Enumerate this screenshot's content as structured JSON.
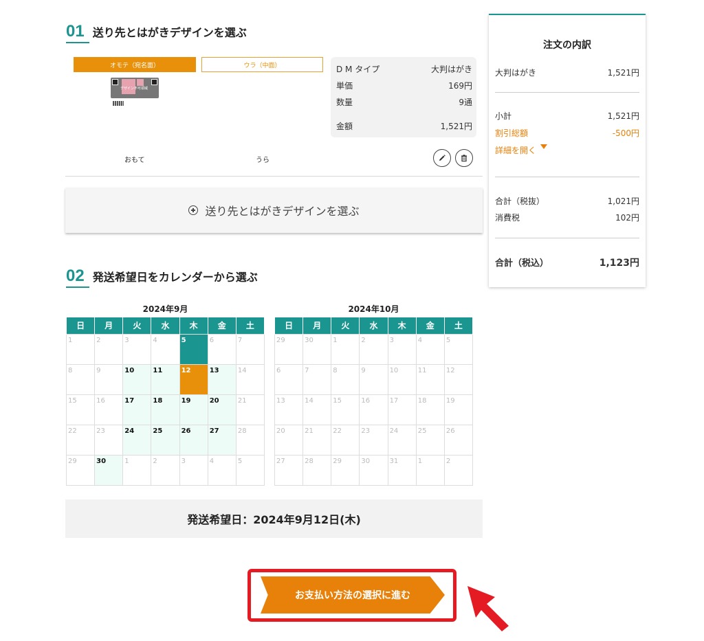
{
  "step1": {
    "num": "01",
    "title": "送り先とはがきデザインを選ぶ"
  },
  "tabs": {
    "front": "オモテ（宛名面）",
    "back": "ウラ（中面）"
  },
  "thumb_text": "デザイン不可領域",
  "summary": {
    "rows": [
      {
        "label": "D M タイプ",
        "value": "大判はがき"
      },
      {
        "label": "単価",
        "value": "169円"
      },
      {
        "label": "数量",
        "value": "9通"
      },
      {
        "label": "金額",
        "value": "1,521円"
      }
    ]
  },
  "face": {
    "front": "おもて",
    "back": "うら"
  },
  "icons": {
    "edit": "pencil-icon",
    "delete": "trash-icon",
    "add": "plus-circle-icon",
    "pointer": "arrow-cursor-icon"
  },
  "add_button": "送り先とはがきデザインを選ぶ",
  "step2": {
    "num": "02",
    "title": "発送希望日をカレンダーから選ぶ"
  },
  "weekdays": [
    "日",
    "月",
    "火",
    "水",
    "木",
    "金",
    "土"
  ],
  "calendars": [
    {
      "title": "2024年9月",
      "weeks": [
        [
          [
            "1",
            "off"
          ],
          [
            "2",
            "off"
          ],
          [
            "3",
            "off"
          ],
          [
            "4",
            "off"
          ],
          [
            "5",
            "today"
          ],
          [
            "6",
            "off"
          ],
          [
            "7",
            "off"
          ]
        ],
        [
          [
            "8",
            "off"
          ],
          [
            "9",
            "off"
          ],
          [
            "10",
            "av"
          ],
          [
            "11",
            "av"
          ],
          [
            "12",
            "sel"
          ],
          [
            "13",
            "av"
          ],
          [
            "14",
            "off"
          ]
        ],
        [
          [
            "15",
            "off"
          ],
          [
            "16",
            "off"
          ],
          [
            "17",
            "av"
          ],
          [
            "18",
            "av"
          ],
          [
            "19",
            "av"
          ],
          [
            "20",
            "av"
          ],
          [
            "21",
            "off"
          ]
        ],
        [
          [
            "22",
            "off"
          ],
          [
            "23",
            "off"
          ],
          [
            "24",
            "av"
          ],
          [
            "25",
            "av"
          ],
          [
            "26",
            "av"
          ],
          [
            "27",
            "av"
          ],
          [
            "28",
            "off"
          ]
        ],
        [
          [
            "29",
            "off"
          ],
          [
            "30",
            "av"
          ],
          [
            "1",
            "off"
          ],
          [
            "2",
            "off"
          ],
          [
            "3",
            "off"
          ],
          [
            "4",
            "off"
          ],
          [
            "5",
            "off"
          ]
        ]
      ]
    },
    {
      "title": "2024年10月",
      "weeks": [
        [
          [
            "29",
            "off"
          ],
          [
            "30",
            "off"
          ],
          [
            "1",
            "off"
          ],
          [
            "2",
            "off"
          ],
          [
            "3",
            "off"
          ],
          [
            "4",
            "off"
          ],
          [
            "5",
            "off"
          ]
        ],
        [
          [
            "6",
            "off"
          ],
          [
            "7",
            "off"
          ],
          [
            "8",
            "off"
          ],
          [
            "9",
            "off"
          ],
          [
            "10",
            "off"
          ],
          [
            "11",
            "off"
          ],
          [
            "12",
            "off"
          ]
        ],
        [
          [
            "13",
            "off"
          ],
          [
            "14",
            "off"
          ],
          [
            "15",
            "off"
          ],
          [
            "16",
            "off"
          ],
          [
            "17",
            "off"
          ],
          [
            "18",
            "off"
          ],
          [
            "19",
            "off"
          ]
        ],
        [
          [
            "20",
            "off"
          ],
          [
            "21",
            "off"
          ],
          [
            "22",
            "off"
          ],
          [
            "23",
            "off"
          ],
          [
            "24",
            "off"
          ],
          [
            "25",
            "off"
          ],
          [
            "26",
            "off"
          ]
        ],
        [
          [
            "27",
            "off"
          ],
          [
            "28",
            "off"
          ],
          [
            "29",
            "off"
          ],
          [
            "30",
            "off"
          ],
          [
            "31",
            "off"
          ],
          [
            "1",
            "off"
          ],
          [
            "2",
            "off"
          ]
        ]
      ]
    }
  ],
  "ship_date": "発送希望日：2024年9月12日(木)",
  "next_button": "お支払い方法の選択に進む",
  "order": {
    "title": "注文の内訳",
    "item": {
      "label": "大判はがき",
      "value": "1,521円"
    },
    "subtotal": {
      "label": "小計",
      "value": "1,521円"
    },
    "discount": {
      "label": "割引総額",
      "value": "-500円"
    },
    "details_link": "詳細を開く",
    "total_ex": {
      "label": "合計（税抜）",
      "value": "1,021円"
    },
    "tax": {
      "label": "消費税",
      "value": "102円"
    },
    "total_in": {
      "label": "合計（税込）",
      "value": "1,123円"
    }
  },
  "colors": {
    "teal": "#1a9590",
    "orange": "#e8810a",
    "red": "#e51b23"
  }
}
